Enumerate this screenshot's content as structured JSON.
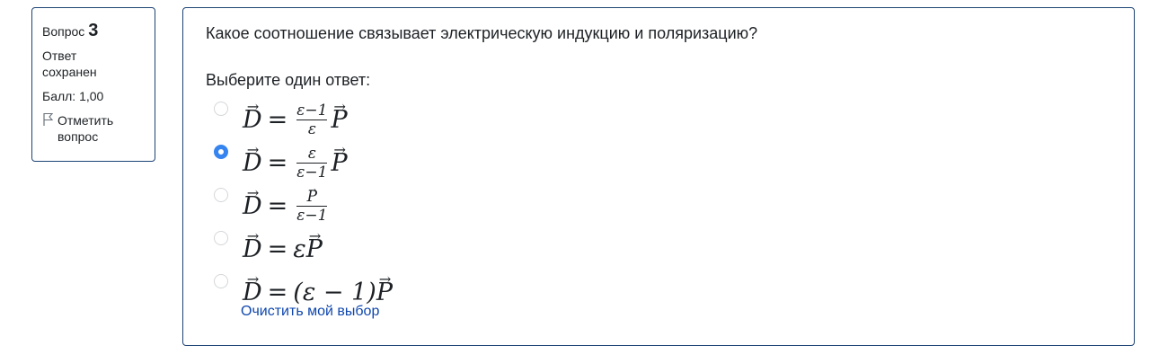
{
  "info": {
    "question_label": "Вопрос",
    "question_number": "3",
    "state": "Ответ сохранен",
    "grade": "Балл: 1,00",
    "flag_label": "Отметить вопрос"
  },
  "question": {
    "text": "Какое соотношение связывает электрическую индукцию и поляризацию?",
    "prompt": "Выберите один ответ:",
    "selected_index": 1,
    "answers": [
      {
        "lhs": "D",
        "eq": "=",
        "num": "ε−1",
        "den": "ε",
        "rhs": "P"
      },
      {
        "lhs": "D",
        "eq": "=",
        "num": "ε",
        "den": "ε−1",
        "rhs": "P"
      },
      {
        "lhs": "D",
        "eq": "=",
        "num": "P",
        "den": "ε−1",
        "rhs": ""
      },
      {
        "lhs": "D",
        "eq": "=",
        "pre": "ε",
        "rhs": "P"
      },
      {
        "lhs": "D",
        "eq": "=",
        "pre": "(ε − 1)",
        "rhs": "P"
      }
    ],
    "clear_label": "Очистить мой выбор"
  },
  "colors": {
    "border": "#1d4474",
    "radio_checked": "#3584f0",
    "link": "#0f47ad"
  },
  "icons": {
    "flag": "flag-icon"
  }
}
